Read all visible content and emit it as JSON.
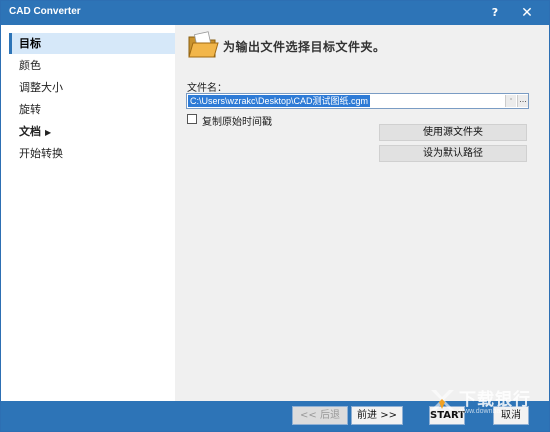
{
  "window": {
    "title": "CAD Converter",
    "help_label": "?",
    "close_label": "✕"
  },
  "sidebar": {
    "items": [
      {
        "label": "目标"
      },
      {
        "label": "颜色"
      },
      {
        "label": "调整大小"
      },
      {
        "label": "旋转"
      },
      {
        "label": "文档"
      },
      {
        "label": "开始转换"
      }
    ],
    "submenu_arrow": "▶"
  },
  "main": {
    "header": "为输出文件选择目标文件夹。",
    "filename_label": "文件名：",
    "filename_value": "C:\\Users\\wzrakc\\Desktop\\CAD测试图纸.cgm",
    "dropdown_glyph": "·",
    "browse_glyph": "...",
    "checkbox_label": "复制原始时间戳",
    "checkbox_checked": false,
    "use_source_folder_button": "使用源文件夹",
    "set_default_path_button": "设为默认路径"
  },
  "footer": {
    "back_label": "<< 后退",
    "next_label": "前进 >>",
    "start_label": "START",
    "cancel_label": "取消"
  },
  "watermark": {
    "text": "下载银行",
    "subtext": "www.downbank.cn"
  },
  "colors": {
    "accent": "#2d74b7",
    "selection": "#2e7bd6",
    "sidebar_active": "#d6e8f9",
    "panel_bg": "#f0f0f0"
  }
}
